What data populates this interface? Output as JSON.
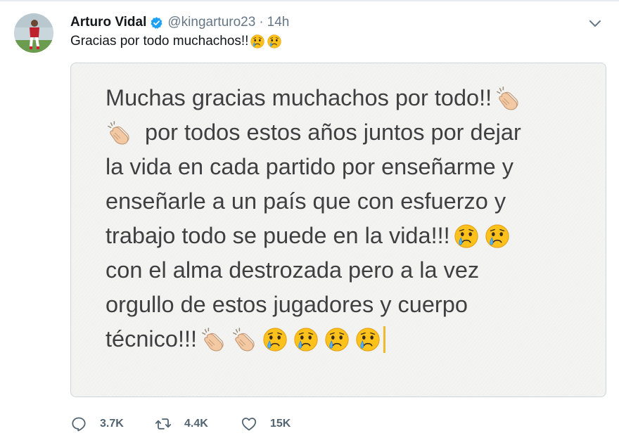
{
  "tweet": {
    "author": {
      "display_name": "Arturo Vidal",
      "verified": true,
      "handle": "@kingarturo23",
      "separator": "·",
      "time": "14h",
      "avatar_icon": "player-avatar"
    },
    "text": "Gracias por todo muchachos!!",
    "text_emojis": [
      "crying-face-icon",
      "crying-face-icon"
    ],
    "media": {
      "type": "notes-screenshot",
      "lines": [
        {
          "text": "Muchas gracias muchachos por todo!!",
          "emojis_after": [
            "clapping-hands-icon"
          ]
        },
        {
          "text": "por todos estos años juntos por dejar",
          "emojis_before": [
            "clapping-hands-icon"
          ]
        },
        {
          "text": "la vida en cada partido por enseñarme y"
        },
        {
          "text": "enseñarle a un país que con esfuerzo y"
        },
        {
          "text": "trabajo todo se puede en la vida!!!",
          "emojis_after": [
            "crying-face-icon",
            "crying-face-icon"
          ]
        },
        {
          "text": "con el alma destrozada pero a la vez"
        },
        {
          "text": "orgullo de estos jugadores y cuerpo"
        },
        {
          "text": "técnico!!!",
          "emojis_after": [
            "clapping-hands-icon",
            "clapping-hands-icon",
            "crying-face-icon",
            "crying-face-icon",
            "crying-face-icon",
            "crying-face-icon"
          ]
        }
      ]
    },
    "actions": {
      "replies": "3.7K",
      "retweets": "4.4K",
      "likes": "15K"
    }
  },
  "colors": {
    "verified_badge": "#1da1f2",
    "secondary_text": "#657786",
    "note_text": "#3f3f42",
    "cursor": "#f0b92e"
  }
}
